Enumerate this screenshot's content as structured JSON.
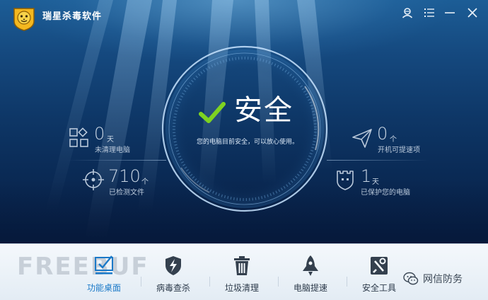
{
  "app": {
    "title": "瑞星杀毒软件"
  },
  "status": {
    "main": "安全",
    "sub": "您的电脑目前安全，可以放心使用。"
  },
  "stats": {
    "cleanup": {
      "value": "0",
      "unit": "天",
      "label": "未清理电脑"
    },
    "scanned": {
      "value": "710",
      "unit": "个",
      "label": "已检测文件"
    },
    "speedup": {
      "value": "0",
      "unit": "个",
      "label": "开机可提速项"
    },
    "protected": {
      "value": "1",
      "unit": "天",
      "label": "已保护您的电脑"
    }
  },
  "toolbar": {
    "items": [
      {
        "label": "功能桌面",
        "icon": "desktop-icon",
        "active": true
      },
      {
        "label": "病毒查杀",
        "icon": "shield-bolt-icon"
      },
      {
        "label": "垃圾清理",
        "icon": "trash-icon"
      },
      {
        "label": "电脑提速",
        "icon": "rocket-icon"
      },
      {
        "label": "安全工具",
        "icon": "toolbox-icon"
      }
    ]
  },
  "watermark": {
    "text": "FREEBUF",
    "account": "网信防务"
  },
  "colors": {
    "accent": "#1b79c8",
    "check": "#7ed321",
    "ocean_dark": "#0a2a55"
  }
}
